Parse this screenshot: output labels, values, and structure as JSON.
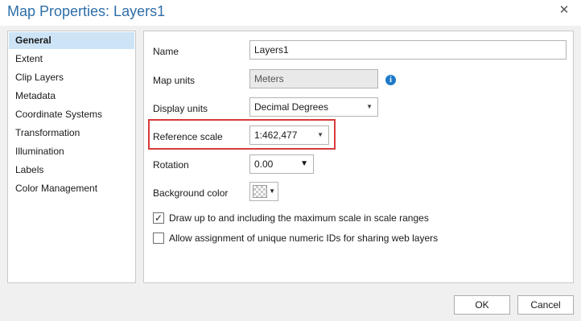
{
  "window": {
    "title": "Map Properties: Layers1",
    "close_glyph": "✕"
  },
  "nav": {
    "items": [
      {
        "label": "General",
        "active": true
      },
      {
        "label": "Extent"
      },
      {
        "label": "Clip Layers"
      },
      {
        "label": "Metadata"
      },
      {
        "label": "Coordinate Systems"
      },
      {
        "label": "Transformation"
      },
      {
        "label": "Illumination"
      },
      {
        "label": "Labels"
      },
      {
        "label": "Color Management"
      }
    ]
  },
  "general": {
    "name": {
      "label": "Name",
      "value": "Layers1"
    },
    "map_units": {
      "label": "Map units",
      "value": "Meters",
      "info_icon": "info-icon"
    },
    "display_units": {
      "label": "Display units",
      "value": "Decimal Degrees"
    },
    "reference_scale": {
      "label": "Reference scale",
      "value": "1:462,477"
    },
    "rotation": {
      "label": "Rotation",
      "value": "0.00"
    },
    "background_color": {
      "label": "Background color"
    },
    "draw_up_to": {
      "label": "Draw up to and including the maximum scale in scale ranges",
      "checked": true
    },
    "unique_ids": {
      "label": "Allow assignment of unique numeric IDs for sharing web layers",
      "checked": false
    }
  },
  "buttons": {
    "ok": "OK",
    "cancel": "Cancel"
  },
  "colors": {
    "title": "#2e6ea8",
    "highlight": "#d83b3b",
    "selected_nav": "#cde4f7",
    "info": "#1e79c8"
  }
}
